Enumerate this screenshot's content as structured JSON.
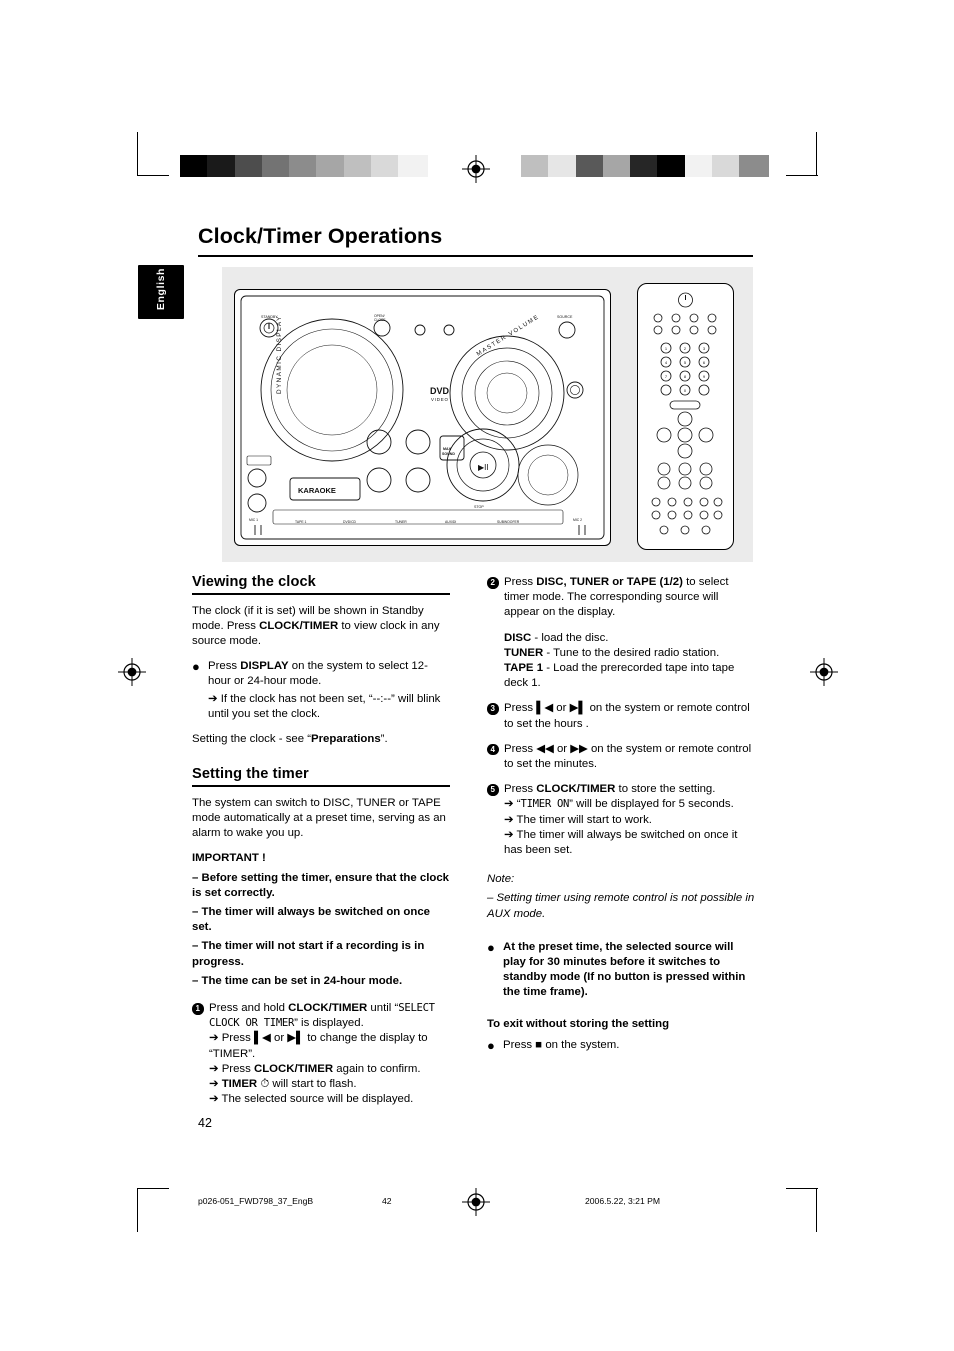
{
  "header": {
    "title": "Clock/Timer Operations",
    "language_tab": "English"
  },
  "figure": {
    "name": "system-and-remote-illustration",
    "unit_labels": {
      "dynamic_display": "DYNAMIC DISPLAY",
      "master_volume": "MASTER VOLUME",
      "dvd_video": "DVD",
      "dvd_video_sub": "VIDEO",
      "karaoke": "KARAOKE",
      "max_sound": "MAX SOUND",
      "standby": "STANDBY",
      "open_close": "OPEN/CLOSE",
      "mic1": "MIC 1",
      "mic2": "MIC 2",
      "play_pause": "▶II",
      "stop": "STOP",
      "source": "SOURCE"
    }
  },
  "left_column": {
    "section1": {
      "heading": "Viewing the clock",
      "para1_a": "The clock (if it is set) will be shown in Standby mode.  Press ",
      "para1_b": "CLOCK/TIMER",
      "para1_c": " to view clock in any source mode.",
      "bullet1_a": "Press ",
      "bullet1_b": "DISPLAY",
      "bullet1_c": " on the system to select 12-hour or 24-hour mode.",
      "bullet1_arrow": "➔ If the clock has not been set, “--:--” will blink until you set the clock.",
      "para2_a": "Setting the clock - see “",
      "para2_b": "Preparations",
      "para2_c": "”."
    },
    "section2": {
      "heading": "Setting the timer",
      "intro": "The system can switch to DISC, TUNER or TAPE  mode automatically at a preset time, serving as an alarm to wake you up.",
      "important_title": "IMPORTANT !",
      "important_items": [
        "–   Before setting the timer, ensure that the clock is set correctly.",
        "–   The timer will always be switched on once set.",
        "–   The timer will not start if a recording is in progress.",
        "–   The time can be set in 24-hour mode."
      ],
      "step1": {
        "num": "1",
        "a": "Press and hold ",
        "b": "CLOCK/TIMER",
        "c": " until “",
        "lcd": "SELECT CLOCK OR TIMER",
        "d": "” is displayed.",
        "arrow1": "➔ Press ▌◀ or ▶▌ to change the display to “TIMER”.",
        "arrow2_a": "➔ Press ",
        "arrow2_b": "CLOCK/TIMER",
        "arrow2_c": " again to confirm.",
        "arrow3_a": "➔ ",
        "arrow3_b": "TIMER",
        "arrow3_c": " ⏱ will start to flash.",
        "arrow4": "➔ The selected source will be displayed."
      }
    }
  },
  "right_column": {
    "step2": {
      "num": "2",
      "a": "Press ",
      "b": "DISC, TUNER or TAPE (1/2)",
      "c": " to select timer mode.  The corresponding source will appear on the display.",
      "disc_b": "DISC",
      "disc_t": " - load the disc.",
      "tuner_b": "TUNER",
      "tuner_t": " - Tune to the desired radio station.",
      "tape_b": "TAPE 1",
      "tape_t": " - Load the prerecorded tape into tape deck 1."
    },
    "step3": {
      "num": "3",
      "text": "Press ▌◀ or ▶▌ on the system or remote control to set the hours ."
    },
    "step4": {
      "num": "4",
      "text": "Press ◀◀ or ▶▶ on the system or remote control to set the minutes."
    },
    "step5": {
      "num": "5",
      "a": "Press ",
      "b": "CLOCK/TIMER",
      "c": " to store the setting.",
      "arrow1_a": "➔ “",
      "arrow1_lcd": "TIMER ON",
      "arrow1_b": "” will be displayed for 5 seconds.",
      "arrow2": "➔ The timer will start to work.",
      "arrow3": "➔ The timer will always be switched on once it has been set."
    },
    "note": {
      "title": "Note:",
      "text": "–   Setting timer using remote control is not possible in AUX mode."
    },
    "preset_bullet": "At the preset time, the selected source will play for 30 minutes before it switches to standby mode (If no button is pressed within the time frame).",
    "exit_title": "To exit without storing the setting",
    "exit_bullet_a": "Press ",
    "exit_bullet_b": "■",
    "exit_bullet_c": " on the system."
  },
  "footer": {
    "page_number": "42",
    "file_name": "p026-051_FWD798_37_EngB",
    "page_center": "42",
    "date": "2006.5.22, 3:21 PM"
  },
  "colors": {
    "figure_background": "#ebebeb",
    "tab_background": "#000000"
  }
}
